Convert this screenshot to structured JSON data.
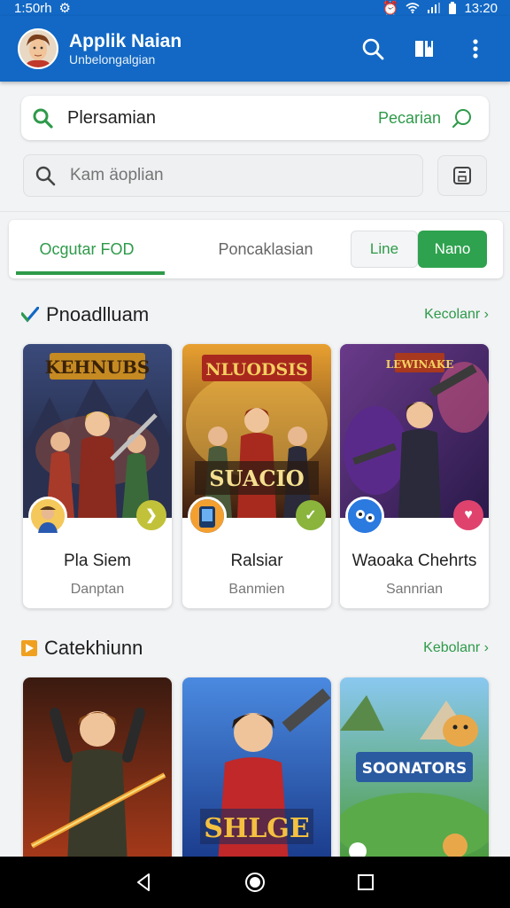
{
  "status": {
    "time_left": "1:50rh",
    "time_right": "13:20"
  },
  "app": {
    "title": "Applik Naian",
    "subtitle": "Unbelongalgian"
  },
  "filter": {
    "label": "Plersamian",
    "action": "Pecarian"
  },
  "search": {
    "placeholder": "Kam äoplian"
  },
  "tabs": {
    "tab1": "Ocgutar FOD",
    "tab2": "Poncaklasian",
    "seg1": "Line",
    "seg2": "Nano"
  },
  "section1": {
    "title": "Pnoadlluam",
    "more": "Kecolanr ›"
  },
  "section2": {
    "title": "Catekhiunn",
    "more": "Kebolanr ›"
  },
  "games": [
    {
      "art_title": "KEHNUBS",
      "name": "Pla Siem",
      "sub": "Danptan",
      "badge_color": "#c2c23a",
      "badge_icon": "❯"
    },
    {
      "art_title": "NLUODSIS",
      "banner": "SUACIO",
      "name": "Ralsiar",
      "sub": "Banmien",
      "badge_color": "#8ab43c",
      "badge_icon": "✓"
    },
    {
      "art_title": "LEWINAKE",
      "name": "Waoaka Chehrts",
      "sub": "Sannrian",
      "badge_color": "#e0426e",
      "badge_icon": "♥"
    }
  ],
  "row2": [
    {
      "banner": ""
    },
    {
      "banner": "SHLGE"
    },
    {
      "banner": "SOONATORS"
    }
  ],
  "colors": {
    "primary": "#1268c4",
    "accent": "#2e9a4a",
    "accent_fill": "#2ea24e"
  },
  "icons": {
    "search": "search-icon",
    "book": "bookmark-icon",
    "more": "more-vert-icon"
  }
}
